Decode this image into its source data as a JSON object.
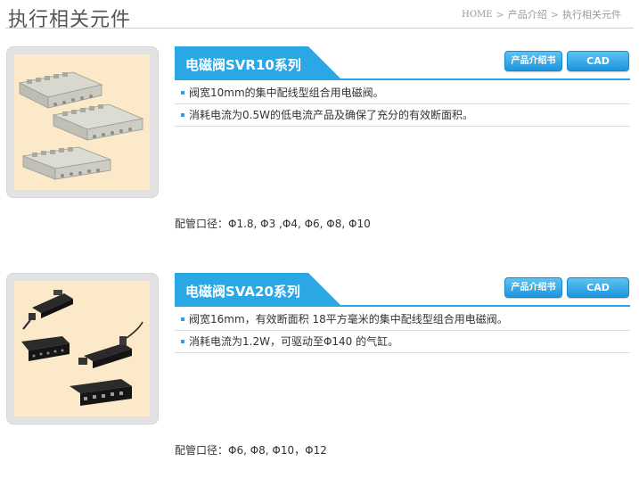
{
  "header": {
    "page_title": "执行相关元件",
    "breadcrumb": {
      "home": "HOME",
      "sep": ">",
      "level1": "产品介绍",
      "current": "执行相关元件"
    }
  },
  "colors": {
    "accent_blue": "#2ba7e6",
    "image_bg": "#fbe9c9"
  },
  "products": [
    {
      "name": "电磁阀SVR10系列",
      "intro_button": "产品介绍书",
      "cad_button": "CAD",
      "bullets": [
        "阀宽10mm的集中配线型组合用电磁阀。",
        "消耗电流为0.5W的低电流产品及确保了充分的有效断面积。"
      ],
      "pipe": "配管口径：Φ1.8, Φ3 ,Φ4, Φ6, Φ8, Φ10"
    },
    {
      "name": "电磁阀SVA20系列",
      "intro_button": "产品介绍书",
      "cad_button": "CAD",
      "bullets": [
        "阀宽16mm，有效断面积 18平方毫米的集中配线型组合用电磁阀。",
        "消耗电流为1.2W，可驱动至Φ140 的气缸。"
      ],
      "pipe": "配管口径：Φ6, Φ8, Φ10，Φ12"
    }
  ]
}
